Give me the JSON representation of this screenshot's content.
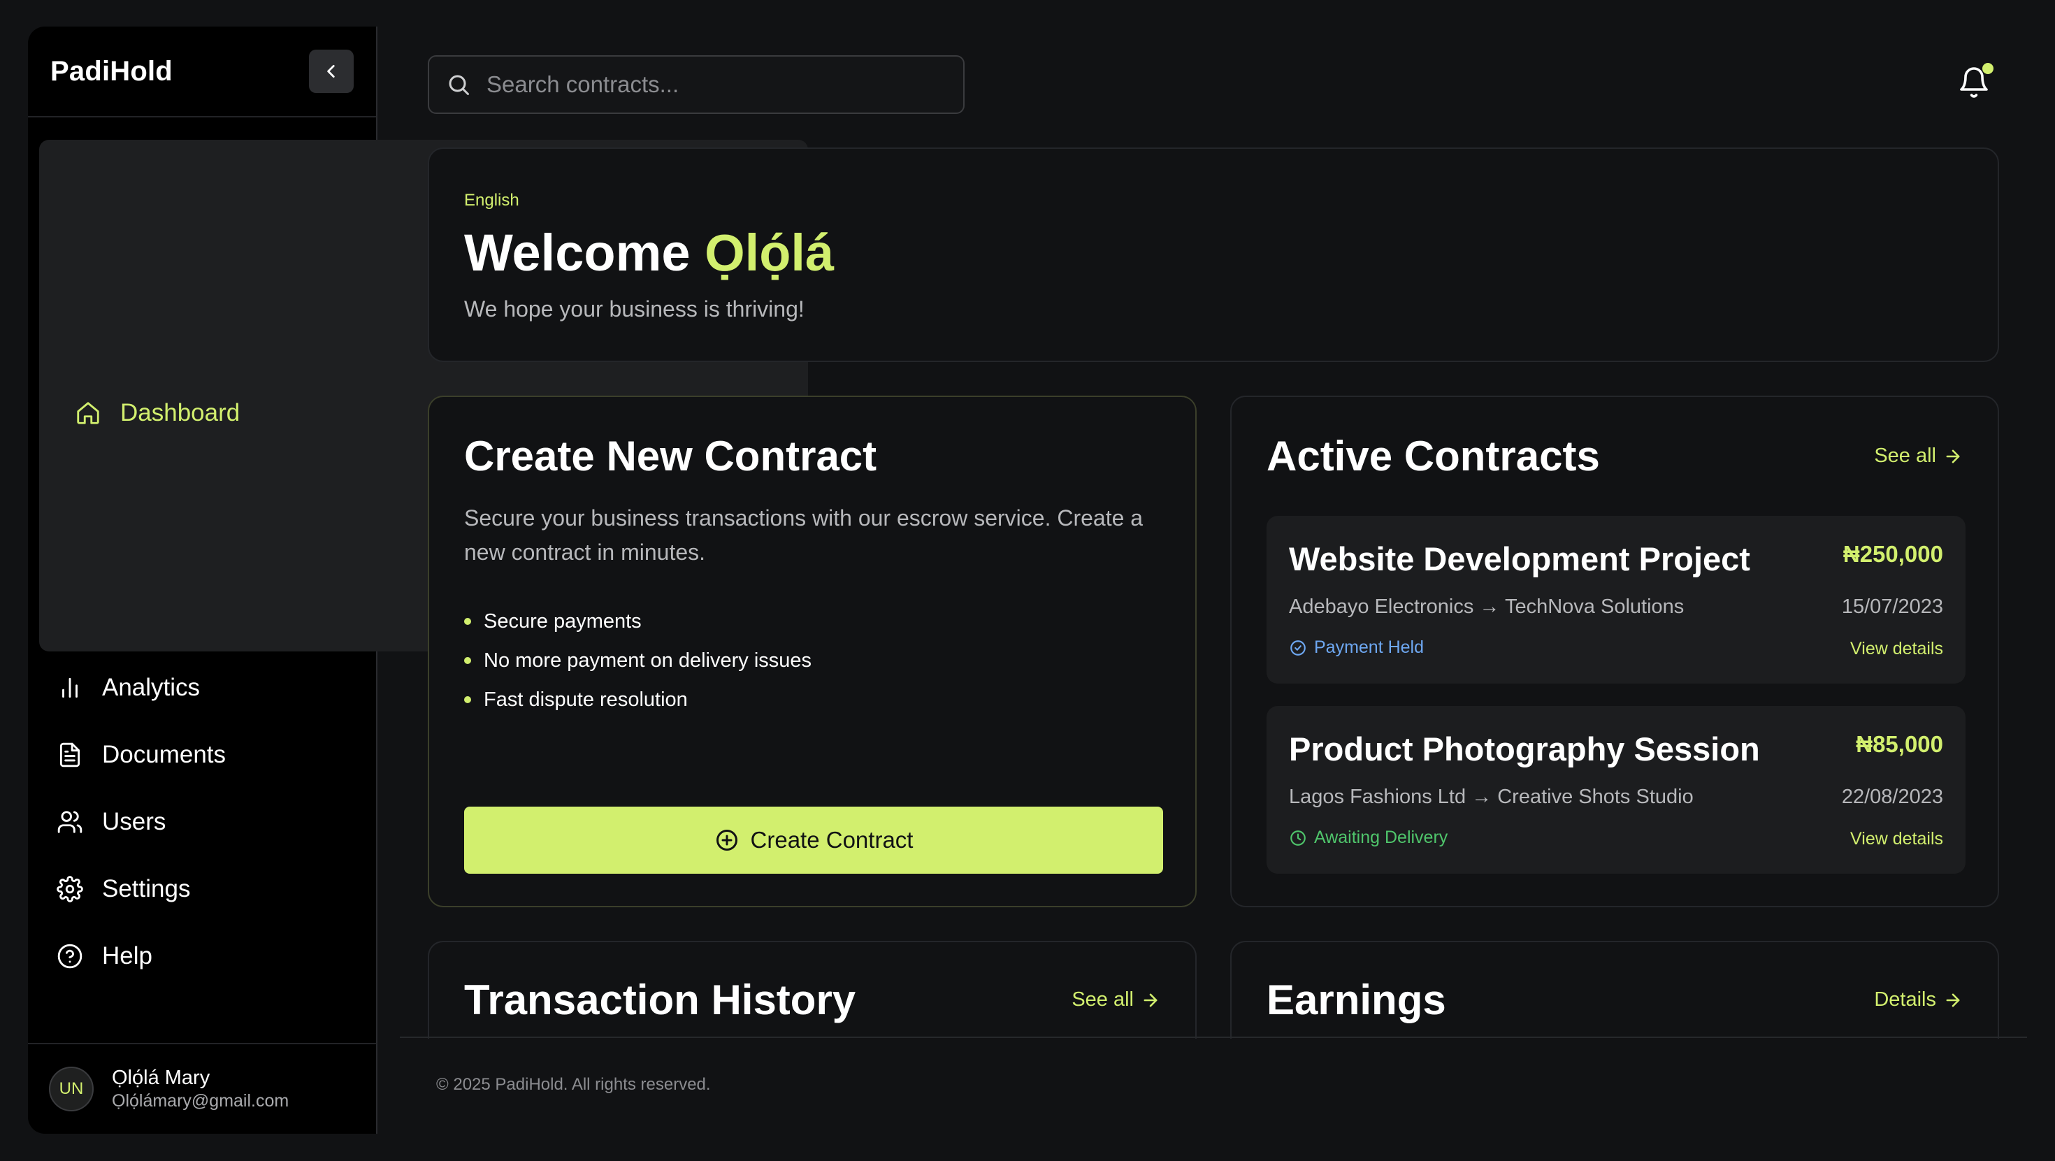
{
  "app": {
    "brand": "PadiHold"
  },
  "sidebar": {
    "items": [
      {
        "label": "Dashboard",
        "icon": "home-icon",
        "active": true
      },
      {
        "label": "Analytics",
        "icon": "bar-chart-icon"
      },
      {
        "label": "Documents",
        "icon": "document-icon"
      },
      {
        "label": "Users",
        "icon": "users-icon"
      },
      {
        "label": "Settings",
        "icon": "gear-icon"
      },
      {
        "label": "Help",
        "icon": "help-circle-icon"
      }
    ],
    "user": {
      "initials": "UN",
      "name": "Ọlọ́lá Mary",
      "email": "Ọlọ́lámary@gmail.com"
    }
  },
  "search": {
    "placeholder": "Search contracts..."
  },
  "welcome": {
    "language": "English",
    "greeting": "Welcome",
    "name": "Ọlọ́lá",
    "subtitle": "We hope your business is thriving!"
  },
  "create_contract": {
    "title": "Create New Contract",
    "description": "Secure your business transactions with our escrow service. Create a new contract in minutes.",
    "bullets": [
      "Secure payments",
      "No more payment on delivery issues",
      "Fast dispute resolution"
    ],
    "button_label": "Create Contract"
  },
  "active_contracts": {
    "title": "Active Contracts",
    "see_all_label": "See all",
    "contracts": [
      {
        "title": "Website Development Project",
        "amount": "₦250,000",
        "parties": "Adebayo Electronics → TechNova Solutions",
        "date": "15/07/2023",
        "status": "Payment Held",
        "status_color": "#6ea8f2",
        "link_label": "View details"
      },
      {
        "title": "Product Photography Session",
        "amount": "₦85,000",
        "parties": "Lagos Fashions Ltd → Creative Shots Studio",
        "date": "22/08/2023",
        "status": "Awaiting Delivery",
        "status_color": "#4fc56b",
        "link_label": "View details"
      }
    ]
  },
  "transaction_history": {
    "title": "Transaction History",
    "see_all_label": "See all"
  },
  "earnings": {
    "title": "Earnings",
    "details_label": "Details"
  },
  "footer": {
    "copyright": "© 2025 PadiHold. All rights reserved."
  },
  "colors": {
    "accent": "#d2ef6e",
    "background": "#111214",
    "sidebar": "#000000"
  }
}
